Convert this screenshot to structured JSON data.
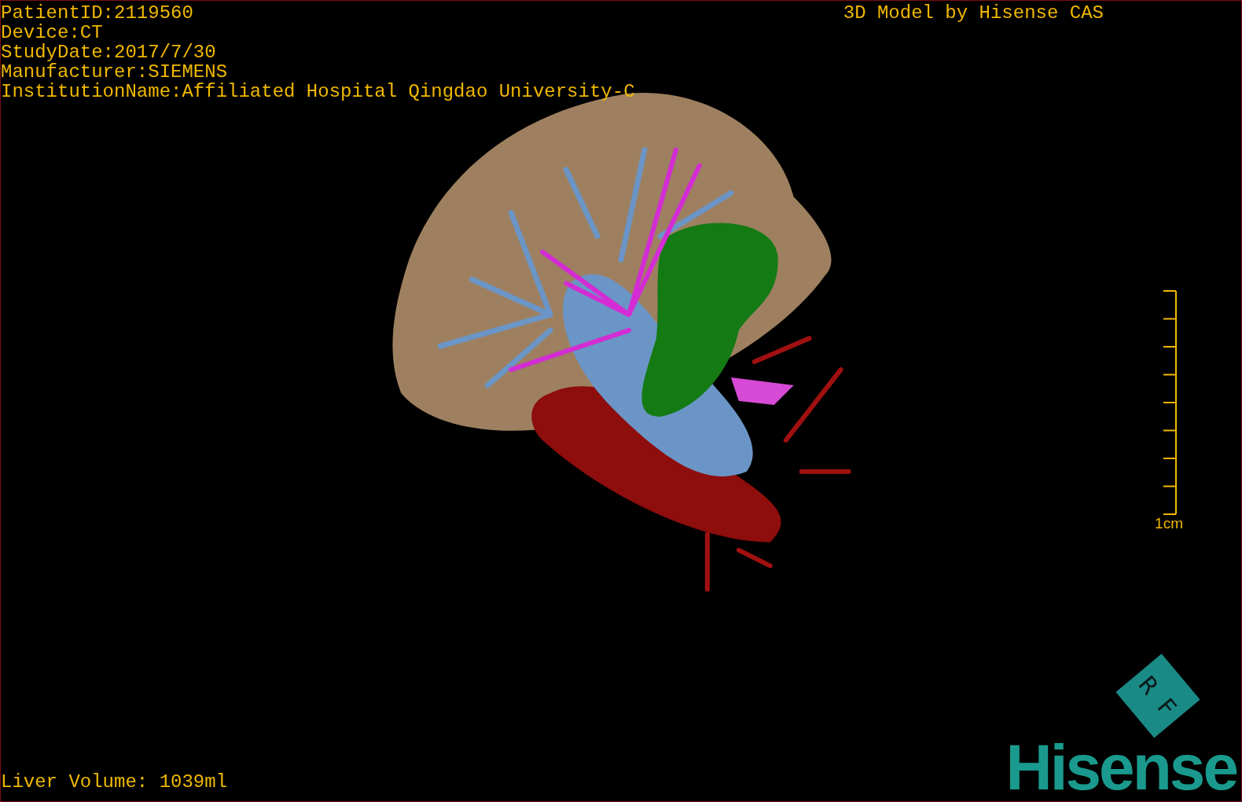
{
  "patient_info": [
    "PatientID:2119560",
    "Device:CT",
    "StudyDate:2017/7/30",
    "Manufacturer:SIEMENS",
    "InstitutionName:Affiliated Hospital Qingdao University-C"
  ],
  "title": "3D Model by Hisense CAS",
  "scale_bar": {
    "label": "1cm"
  },
  "liver_volume": "Liver Volume: 1039ml",
  "logo": {
    "badge": "R F",
    "wordmark": "Hisense"
  }
}
